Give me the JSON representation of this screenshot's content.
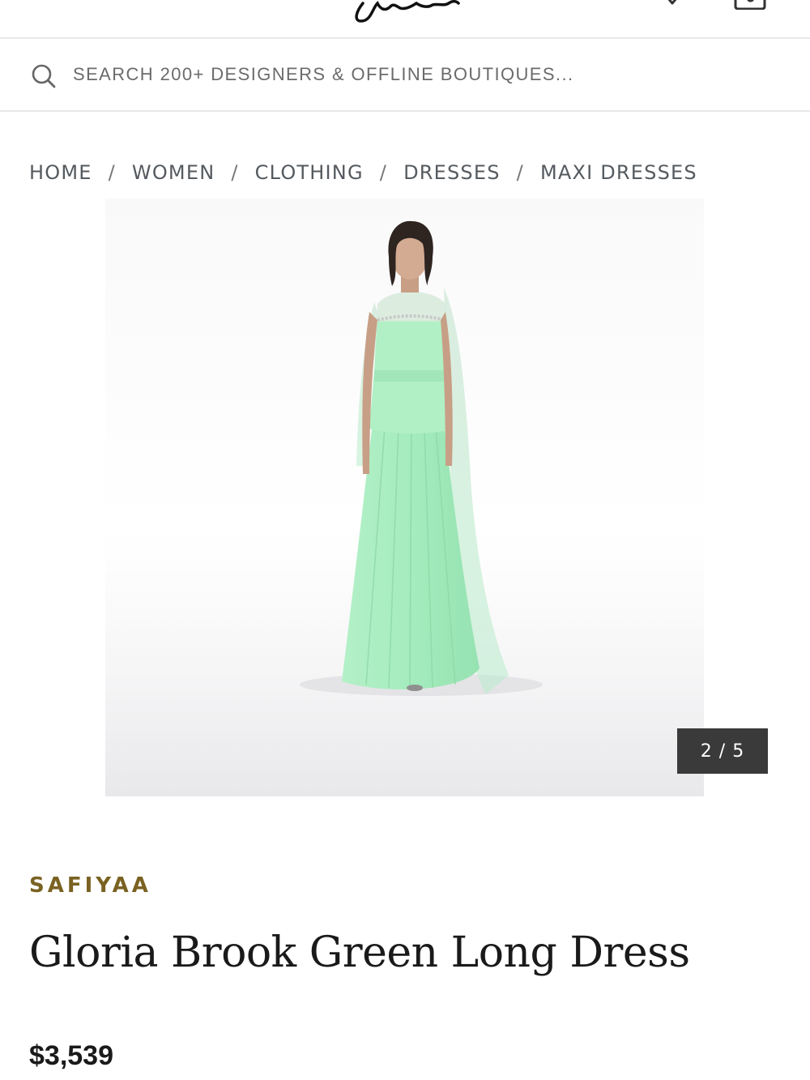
{
  "header": {
    "menu_icon": "hamburger-menu-icon",
    "logo_icon": "script-logo",
    "wishlist_icon": "heart-icon",
    "cart_icon": "shopping-bag-icon"
  },
  "search": {
    "placeholder": "SEARCH 200+ DESIGNERS & OFFLINE BOUTIQUES...",
    "icon": "search-icon"
  },
  "breadcrumb": {
    "separator": "/",
    "items": [
      {
        "label": "HOME"
      },
      {
        "label": "WOMEN"
      },
      {
        "label": "CLOTHING"
      },
      {
        "label": "DRESSES"
      },
      {
        "label": "MAXI DRESSES"
      }
    ]
  },
  "gallery": {
    "counter": "2 / 5",
    "current": 2,
    "total": 5
  },
  "product": {
    "brand": "SAFIYAA",
    "title": "Gloria Brook Green Long Dress",
    "price": "$3,539"
  },
  "colors": {
    "brand_gold": "#7a6222",
    "dress_green": "#a8ecc0",
    "counter_bg": "#3a3a3a"
  }
}
